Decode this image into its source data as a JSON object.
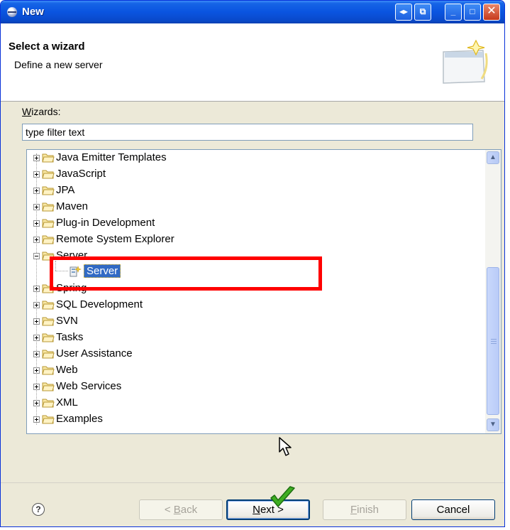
{
  "window": {
    "title": "New"
  },
  "title_buttons": {
    "left_right": "◂▸",
    "restore": "⧉",
    "minimize": "_",
    "maximize": "□",
    "close": "✕"
  },
  "banner": {
    "heading": "Select a wizard",
    "description": "Define a new server"
  },
  "wizards": {
    "label_prefix": "W",
    "label_rest": "izards:",
    "filter_value": "type filter text"
  },
  "tree": {
    "items_top": [
      {
        "label": "Java Emitter Templates"
      },
      {
        "label": "JavaScript"
      },
      {
        "label": "JPA"
      },
      {
        "label": "Maven"
      },
      {
        "label": "Plug-in Development"
      },
      {
        "label": "Remote System Explorer"
      }
    ],
    "server_group": {
      "label": "Server",
      "child": "Server"
    },
    "items_bottom": [
      {
        "label": "Spring"
      },
      {
        "label": "SQL Development"
      },
      {
        "label": "SVN"
      },
      {
        "label": "Tasks"
      },
      {
        "label": "User Assistance"
      },
      {
        "label": "Web"
      },
      {
        "label": "Web Services"
      },
      {
        "label": "XML"
      },
      {
        "label": "Examples"
      }
    ]
  },
  "scrollbar": {
    "up": "▲",
    "down": "▼"
  },
  "buttons": {
    "help": "?",
    "back_mnemonic": "B",
    "back_prefix": "< ",
    "back_rest": "ack",
    "next_mnemonic": "N",
    "next_rest": "ext >",
    "finish_mnemonic": "F",
    "finish_rest": "inish",
    "cancel": "Cancel"
  },
  "colors": {
    "selection": "#316ac5",
    "highlight_box": "#ff0000",
    "titlebar": "#0a54e0",
    "checkmark": "#2e9f1a"
  }
}
